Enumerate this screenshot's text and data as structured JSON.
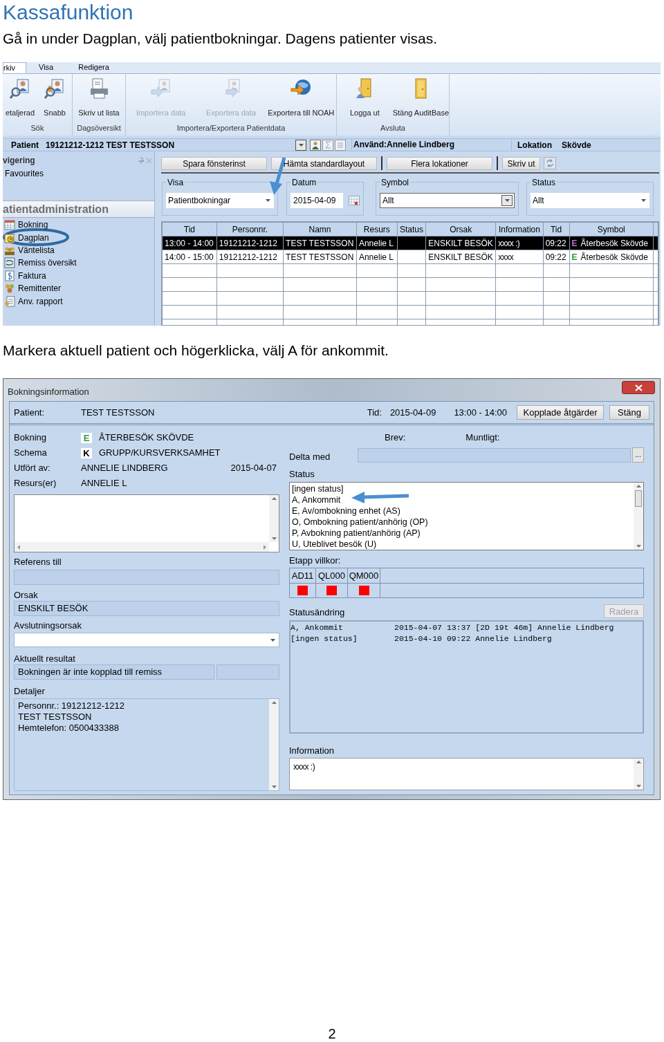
{
  "heading": "Kassafunktion",
  "intro": "Gå in under Dagplan, välj patientbokningar. Dagens patienter visas.",
  "screenshot_1": {
    "menu_tabs": [
      {
        "label": "rkiv",
        "selected": true
      },
      {
        "label": "Visa",
        "selected": false
      },
      {
        "label": "Redigera",
        "selected": false
      }
    ],
    "ribbon_groups": [
      {
        "title": "Sök",
        "buttons": [
          {
            "label": "etaljerad",
            "kind": "detail-search",
            "disabled": false
          },
          {
            "label": "Snabb",
            "kind": "quick-search",
            "disabled": false
          }
        ]
      },
      {
        "title": "Dagsöversikt",
        "buttons": [
          {
            "label": "Skriv ut lista",
            "kind": "print",
            "disabled": false
          }
        ]
      },
      {
        "title": "Importera/Exportera Patientdata",
        "buttons": [
          {
            "label": "Importera data",
            "kind": "import",
            "disabled": true
          },
          {
            "label": "Exportera data",
            "kind": "export",
            "disabled": true
          },
          {
            "label": "Exportera till NOAH",
            "kind": "noah",
            "disabled": false
          }
        ]
      },
      {
        "title": "Avsluta",
        "buttons": [
          {
            "label": "Logga ut",
            "kind": "logout",
            "disabled": false
          },
          {
            "label": "Stäng AuditBase",
            "kind": "close-app",
            "disabled": false
          }
        ]
      }
    ],
    "patient_bar": {
      "label": "Patient",
      "value": "19121212-1212 TEST TESTSSON",
      "user": "Använd:Annelie Lindberg",
      "location_label": "Lokation",
      "location": "Skövde"
    },
    "sidebar": {
      "title": "vigering",
      "favourites": "Favourites",
      "section": "atientadministration",
      "items": [
        {
          "label": "Bokning",
          "kind": "calendar"
        },
        {
          "label": "Dagplan",
          "kind": "dayplan"
        },
        {
          "label": "Väntelista",
          "kind": "people"
        },
        {
          "label": "Remiss översikt",
          "kind": "referral"
        },
        {
          "label": "Faktura",
          "kind": "invoice"
        },
        {
          "label": "Remittenter",
          "kind": "senders"
        },
        {
          "label": "Anv. rapport",
          "kind": "report"
        }
      ]
    },
    "toolbar": [
      "Spara fönsterinst",
      "Hämta standardlayout",
      "Flera lokationer",
      "Skriv ut"
    ],
    "filters": [
      {
        "label": "Visa",
        "value": "Patientbokningar",
        "kind": "dropdown"
      },
      {
        "label": "Datum",
        "value": "2015-04-09",
        "kind": "date"
      },
      {
        "label": "Symbol",
        "value": "Allt",
        "kind": "dropdown"
      },
      {
        "label": "Status",
        "value": "Allt",
        "kind": "dropdown"
      }
    ],
    "table": {
      "columns": [
        "Tid",
        "Personnr.",
        "Namn",
        "Resurs",
        "Status",
        "Orsak",
        "Information",
        "Tid",
        "Symbol"
      ],
      "rows": [
        {
          "selected": true,
          "tid": "13:00 - 14:00",
          "personnr": "19121212-1212",
          "namn": "TEST TESTSSON",
          "resurs": "Annelie L",
          "orsak": "ENSKILT BESÖK",
          "information": "xxxx :)",
          "time": "09:22",
          "symbol_letter": "E",
          "color": "#c070c8",
          "symbol": "Återbesök Skövde"
        },
        {
          "selected": false,
          "tid": "14:00 - 15:00",
          "personnr": "19121212-1212",
          "namn": "TEST TESTSSON",
          "resurs": "Annelie L",
          "orsak": "ENSKILT BESÖK",
          "information": "xxxx",
          "time": "09:22",
          "symbol_letter": "E",
          "color": "#2e9a3e",
          "symbol": "Återbesök Skövde"
        }
      ]
    }
  },
  "instruction": "Markera aktuell patient och högerklicka, välj A för ankommit.",
  "screenshot_2": {
    "title": "Bokningsinformation",
    "patient_label": "Patient:",
    "patient": "TEST TESTSSON",
    "time_label": "Tid:",
    "date": "2015-04-09",
    "time": "13:00 - 14:00",
    "buttons": [
      "Kopplade åtgärder",
      "Stäng"
    ],
    "details": [
      {
        "label": "Bokning",
        "badge": "E",
        "color": "#2a9a3a",
        "value": "ÅTERBESÖK SKÖVDE"
      },
      {
        "label": "Schema",
        "badge": "K",
        "color": "#000000",
        "value": "GRUPP/KURSVERKSAMHET"
      },
      {
        "label": "Utfört av:",
        "value": "ANNELIE LINDBERG",
        "date": "2015-04-07"
      },
      {
        "label": "Resurs(er)",
        "value": "ANNELIE L"
      }
    ],
    "reference_label": "Referens till",
    "reason_label": "Orsak",
    "reason": "ENSKILT BESÖK",
    "closing_label": "Avslutningsorsak",
    "result_label": "Aktuellt resultat",
    "result": "Bokningen är inte kopplad till remiss",
    "details_label": "Detaljer",
    "details_text": [
      "Personnr.: 19121212-1212",
      "TEST TESTSSON",
      "Hemtelefon: 0500433388"
    ],
    "letter_label": "Brev:",
    "oral_label": "Muntligt:",
    "participate_label": "Delta med",
    "more_button": "...",
    "status_label": "Status",
    "status_options": [
      "[ingen status]",
      "A, Ankommit",
      "E, Av/ombokning enhet (AS)",
      "O, Ombokning patient/anhörig (OP)",
      "P, Avbokning patient/anhörig (AP)",
      "U, Uteblivet besök (U)"
    ],
    "stage_label": "Etapp villkor:",
    "stages": [
      "AD11",
      "QL000",
      "QM000"
    ],
    "status_change_label": "Statusändring",
    "delete_button": {
      "label": "Radera",
      "disabled": true
    },
    "status_changes": [
      {
        "status": "A, Ankommit",
        "info": "2015-04-07 13:37 [2D 19t 46m] Annelie Lindberg"
      },
      {
        "status": "[ingen status]",
        "info": "2015-04-10 09:22 Annelie Lindberg"
      }
    ],
    "information_label": "Information",
    "information": "xxxx :)"
  },
  "page_number": "2"
}
